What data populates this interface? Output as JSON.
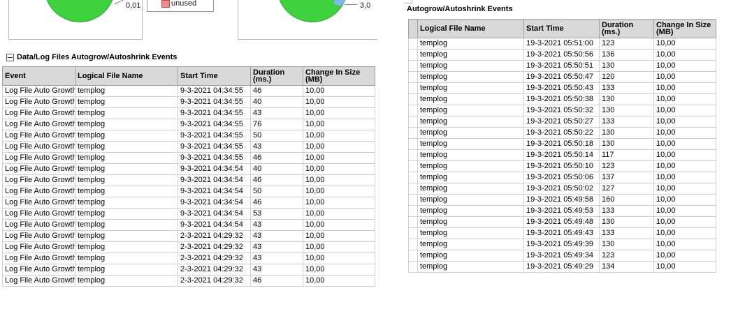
{
  "left": {
    "pie_left_label": "0,01",
    "pie_right_label": "3,0",
    "legend_label": "unused",
    "section_title": "Data/Log Files Autogrow/Autoshrink Events",
    "columns": [
      "Event",
      "Logical File Name",
      "Start Time",
      "Duration (ms.)",
      "Change In Size (MB)"
    ],
    "rows": [
      [
        "Log File Auto Growth",
        "templog",
        "9-3-2021 04:34:55",
        "46",
        "10,00"
      ],
      [
        "Log File Auto Growth",
        "templog",
        "9-3-2021 04:34:55",
        "40",
        "10,00"
      ],
      [
        "Log File Auto Growth",
        "templog",
        "9-3-2021 04:34:55",
        "43",
        "10,00"
      ],
      [
        "Log File Auto Growth",
        "templog",
        "9-3-2021 04:34:55",
        "76",
        "10,00"
      ],
      [
        "Log File Auto Growth",
        "templog",
        "9-3-2021 04:34:55",
        "50",
        "10,00"
      ],
      [
        "Log File Auto Growth",
        "templog",
        "9-3-2021 04:34:55",
        "43",
        "10,00"
      ],
      [
        "Log File Auto Growth",
        "templog",
        "9-3-2021 04:34:55",
        "46",
        "10,00"
      ],
      [
        "Log File Auto Growth",
        "templog",
        "9-3-2021 04:34:54",
        "40",
        "10,00"
      ],
      [
        "Log File Auto Growth",
        "templog",
        "9-3-2021 04:34:54",
        "46",
        "10,00"
      ],
      [
        "Log File Auto Growth",
        "templog",
        "9-3-2021 04:34:54",
        "50",
        "10,00"
      ],
      [
        "Log File Auto Growth",
        "templog",
        "9-3-2021 04:34:54",
        "46",
        "10,00"
      ],
      [
        "Log File Auto Growth",
        "templog",
        "9-3-2021 04:34:54",
        "53",
        "10,00"
      ],
      [
        "Log File Auto Growth",
        "templog",
        "9-3-2021 04:34:54",
        "43",
        "10,00"
      ],
      [
        "Log File Auto Growth",
        "templog",
        "2-3-2021 04:29:32",
        "43",
        "10,00"
      ],
      [
        "Log File Auto Growth",
        "templog",
        "2-3-2021 04:29:32",
        "43",
        "10,00"
      ],
      [
        "Log File Auto Growth",
        "templog",
        "2-3-2021 04:29:32",
        "43",
        "10,00"
      ],
      [
        "Log File Auto Growth",
        "templog",
        "2-3-2021 04:29:32",
        "43",
        "10,00"
      ],
      [
        "Log File Auto Growth",
        "templog",
        "2-3-2021 04:29:32",
        "46",
        "10,00"
      ]
    ]
  },
  "right": {
    "section_title": "Autogrow/Autoshrink Events",
    "columns": [
      "Logical File Name",
      "Start Time",
      "Duration (ms.)",
      "Change In Size (MB)"
    ],
    "rows": [
      [
        "templog",
        "19-3-2021 05:51:00",
        "123",
        "10,00"
      ],
      [
        "templog",
        "19-3-2021 05:50:56",
        "136",
        "10,00"
      ],
      [
        "templog",
        "19-3-2021 05:50:51",
        "130",
        "10,00"
      ],
      [
        "templog",
        "19-3-2021 05:50:47",
        "120",
        "10,00"
      ],
      [
        "templog",
        "19-3-2021 05:50:43",
        "133",
        "10,00"
      ],
      [
        "templog",
        "19-3-2021 05:50:38",
        "130",
        "10,00"
      ],
      [
        "templog",
        "19-3-2021 05:50:32",
        "130",
        "10,00"
      ],
      [
        "templog",
        "19-3-2021 05:50:27",
        "133",
        "10,00"
      ],
      [
        "templog",
        "19-3-2021 05:50:22",
        "130",
        "10,00"
      ],
      [
        "templog",
        "19-3-2021 05:50:18",
        "130",
        "10,00"
      ],
      [
        "templog",
        "19-3-2021 05:50:14",
        "117",
        "10,00"
      ],
      [
        "templog",
        "19-3-2021 05:50:10",
        "123",
        "10,00"
      ],
      [
        "templog",
        "19-3-2021 05:50:06",
        "137",
        "10,00"
      ],
      [
        "templog",
        "19-3-2021 05:50:02",
        "127",
        "10,00"
      ],
      [
        "templog",
        "19-3-2021 05:49:58",
        "160",
        "10,00"
      ],
      [
        "templog",
        "19-3-2021 05:49:53",
        "133",
        "10,00"
      ],
      [
        "templog",
        "19-3-2021 05:49:48",
        "130",
        "10,00"
      ],
      [
        "templog",
        "19-3-2021 05:49:43",
        "133",
        "10,00"
      ],
      [
        "templog",
        "19-3-2021 05:49:39",
        "130",
        "10,00"
      ],
      [
        "templog",
        "19-3-2021 05:49:34",
        "123",
        "10,00"
      ],
      [
        "templog",
        "19-3-2021 05:49:29",
        "134",
        "10,00"
      ]
    ]
  },
  "colors": {
    "pie_green": "#3fd23f",
    "pie_blue": "#7fb6e8",
    "legend_unused": "#ee8a8a",
    "header_bg": "#d9d9d9"
  }
}
